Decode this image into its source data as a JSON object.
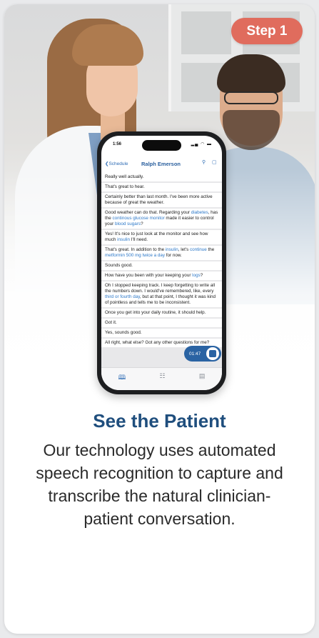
{
  "step_badge": "Step 1",
  "phone": {
    "status_time": "1:56",
    "status_icons": "▂▄ ◠ ▬",
    "nav_back": "❮Schedule",
    "nav_title": "Ralph Emerson",
    "search_icon": "⚲",
    "chat_icon": "▢",
    "recording_time": "01:47",
    "transcript": [
      [
        {
          "t": "Really well actually."
        }
      ],
      [
        {
          "t": "That's great to hear."
        }
      ],
      [
        {
          "t": "Certainly better than last month. I've been more active because of great the weather."
        }
      ],
      [
        {
          "t": "Good weather can do that. Regarding your "
        },
        {
          "t": "diabetes",
          "hl": true
        },
        {
          "t": ", has the "
        },
        {
          "t": "continous glucose monitor",
          "hl": true
        },
        {
          "t": " made it easier to control your "
        },
        {
          "t": "blood sugars",
          "hl": true
        },
        {
          "t": "?"
        }
      ],
      [
        {
          "t": "Yes! It's nice to just look at the monitor and see how much "
        },
        {
          "t": "insulin",
          "hl": true
        },
        {
          "t": " I'll need."
        }
      ],
      [
        {
          "t": "That's great. In addition to the "
        },
        {
          "t": "insulin",
          "hl": true
        },
        {
          "t": ", let's "
        },
        {
          "t": "continue",
          "hl": true
        },
        {
          "t": " the "
        },
        {
          "t": "metformin 500 mg twice a day",
          "hl": true
        },
        {
          "t": " for now."
        }
      ],
      [
        {
          "t": "Sounds good."
        }
      ],
      [
        {
          "t": "How have you been with your keeping your "
        },
        {
          "t": "logs",
          "hl": true
        },
        {
          "t": "?"
        }
      ],
      [
        {
          "t": "Oh I stopped keeping track. I keep forgetting to write all the numbers down. I would've remembered, like, every "
        },
        {
          "t": "third or fourth day",
          "hl": true
        },
        {
          "t": ", but at that point, I thought it was kind of pointless and tells me to be inconsistent."
        }
      ],
      [
        {
          "t": "Once you get into your daily routine, it should help."
        }
      ],
      [
        {
          "t": "Got it."
        }
      ],
      [
        {
          "t": "Yes, sounds good."
        }
      ],
      [
        {
          "t": "All right, what else? Got any other questions for me?"
        }
      ]
    ],
    "tabs": [
      {
        "icon": "book-icon",
        "glyph": "🕮",
        "active": true
      },
      {
        "icon": "org-chart-icon",
        "glyph": "☷",
        "active": false
      },
      {
        "icon": "document-icon",
        "glyph": "▤",
        "active": false
      }
    ]
  },
  "heading": "See the Patient",
  "description": "Our technology uses automated speech recognition to capture and transcribe the natural clinician-patient conversation.",
  "colors": {
    "badge": "#e06c5d",
    "heading": "#1f4e7d",
    "app_accent": "#2a63a3",
    "highlight": "#2c78c8"
  }
}
